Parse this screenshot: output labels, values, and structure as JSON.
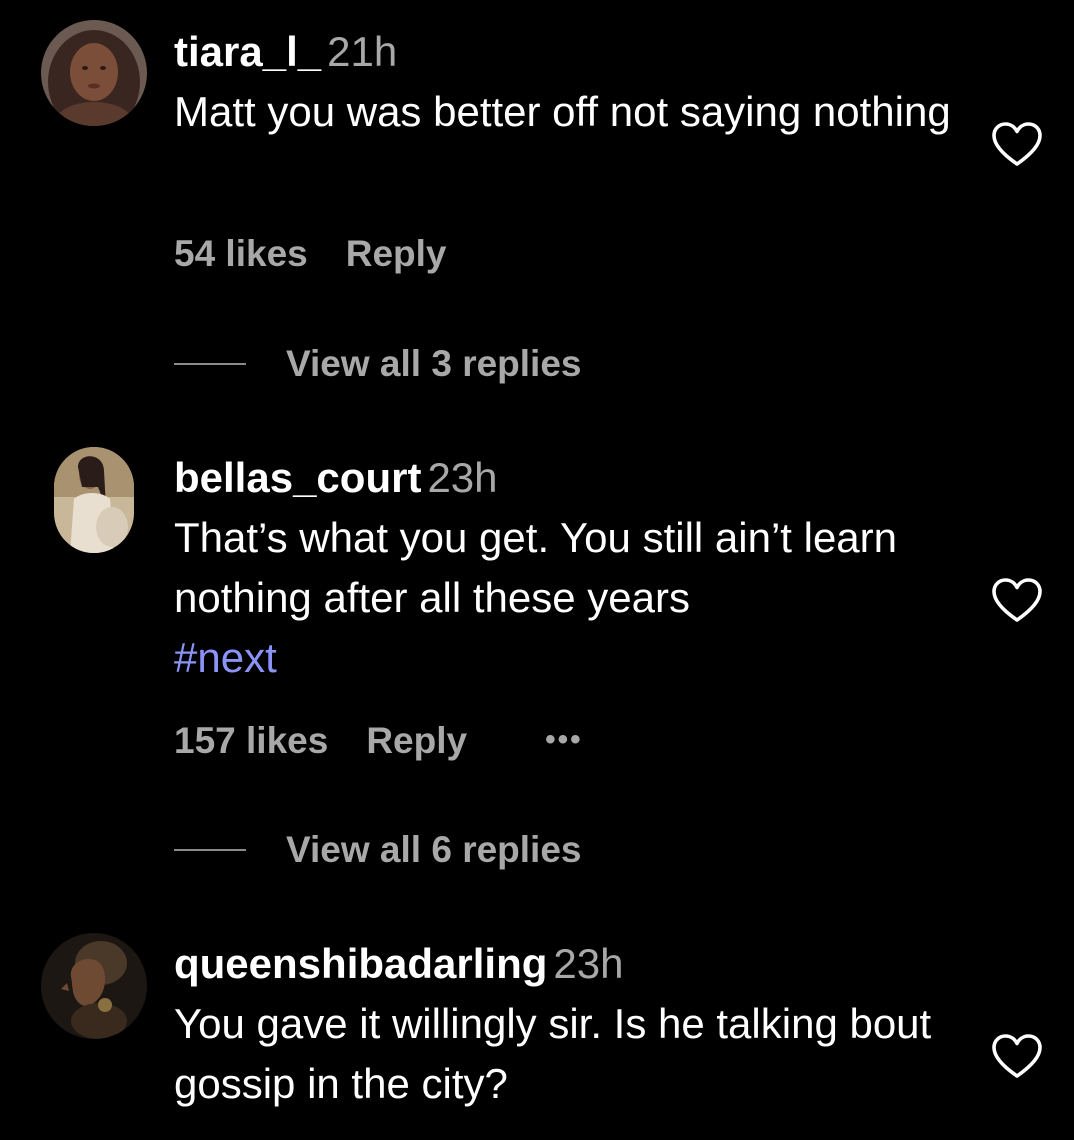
{
  "comments": [
    {
      "username": "tiara_l_",
      "time": "21h",
      "text": "Matt you was better off not saying nothing",
      "likes": "54 likes",
      "reply_label": "Reply",
      "view_replies": "View all 3 replies"
    },
    {
      "username": "bellas_court",
      "time": "23h",
      "text": "That’s what you get. You still ain’t learn nothing after all these years",
      "hashtag": "#next",
      "likes": "157 likes",
      "reply_label": "Reply",
      "more_label": "•••",
      "view_replies": "View all 6 replies"
    },
    {
      "username": "queenshibadarling",
      "time": "23h",
      "text": "You gave it willingly sir. Is he talking bout gossip in the city?"
    }
  ],
  "colors": {
    "background": "#000000",
    "primary_text": "#ffffff",
    "secondary_text": "#a8a8a8",
    "hashtag": "#8c93f7"
  },
  "icons": {
    "like": "heart-outline-icon",
    "more": "more-horizontal-icon"
  }
}
